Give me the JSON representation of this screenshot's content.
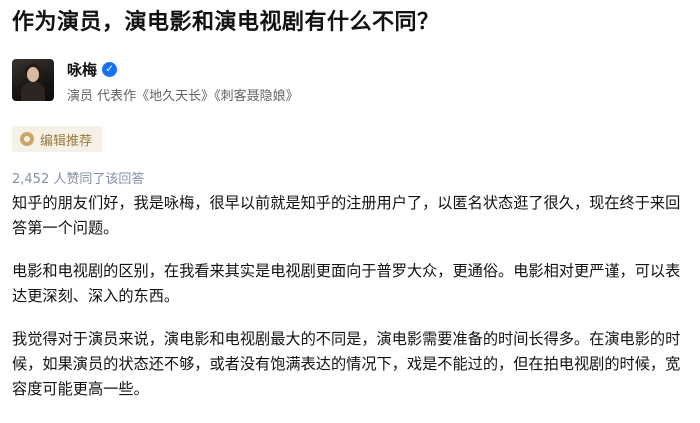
{
  "question": {
    "title": "作为演员，演电影和演电视剧有什么不同？"
  },
  "author": {
    "name": "咏梅",
    "verified_icon": "verified-check-icon",
    "verified_color": "#1772f6",
    "headline": "演员 代表作《地久天长》《刺客聂隐娘》"
  },
  "badge": {
    "icon": "editor-pick-icon",
    "label": "编辑推荐",
    "color": "#9a7b40"
  },
  "answer": {
    "vote_summary": "2,452 人赞同了该回答",
    "paragraphs": [
      "知乎的朋友们好，我是咏梅，很早以前就是知乎的注册用户了，以匿名状态逛了很久，现在终于来回答第一个问题。",
      "电影和电视剧的区别，在我看来其实是电视剧更面向于普罗大众，更通俗。电影相对更严谨，可以表达更深刻、深入的东西。",
      "我觉得对于演员来说，演电影和电视剧最大的不同是，演电影需要准备的时间长得多。在演电影的时候，如果演员的状态还不够，或者没有饱满表达的情况下，戏是不能过的，但在拍电视剧的时候，宽容度可能更高一些。"
    ]
  }
}
